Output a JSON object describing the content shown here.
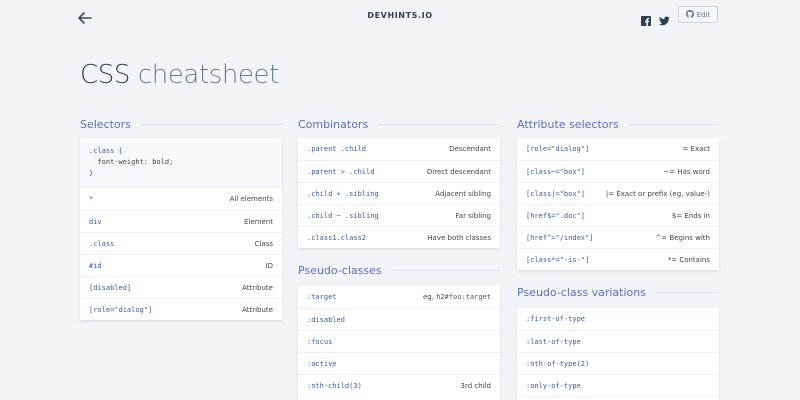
{
  "header": {
    "site_name": "DEVHINTS.IO",
    "edit_label": "Edit"
  },
  "title": {
    "main": "CSS",
    "light": "cheatsheet"
  },
  "selectors": {
    "title": "Selectors",
    "code_lines": [
      ".class {",
      "  font-weight: bold;",
      "}"
    ],
    "rows": [
      {
        "code": "*",
        "desc": "All elements"
      },
      {
        "code": "div",
        "desc": "Element"
      },
      {
        "code": ".class",
        "desc": "Class"
      },
      {
        "code": "#id",
        "desc": "ID"
      },
      {
        "code": "[disabled]",
        "desc": "Attribute"
      },
      {
        "code": "[role=\"dialog\"]",
        "desc": "Attribute"
      }
    ]
  },
  "combinators": {
    "title": "Combinators",
    "rows": [
      {
        "code": ".parent .child",
        "desc": "Descendant"
      },
      {
        "code": ".parent > .child",
        "desc": "Direct descendant"
      },
      {
        "code": ".child + .sibling",
        "desc": "Adjacent sibling"
      },
      {
        "code": ".child ~ .sibling",
        "desc": "Far sibling"
      },
      {
        "code": ".class1.class2",
        "desc": "Have both classes"
      }
    ]
  },
  "pseudo_classes": {
    "title": "Pseudo-classes",
    "rows": [
      {
        "code": ":target",
        "desc_prefix": "eg,",
        "desc_code": "h2#foo:target"
      },
      {
        "code": ":disabled",
        "desc": ""
      },
      {
        "code": ":focus",
        "desc": ""
      },
      {
        "code": ":active",
        "desc": ""
      },
      {
        "code": ":nth-child(3)",
        "desc": "3rd child"
      }
    ]
  },
  "attribute_selectors": {
    "title": "Attribute selectors",
    "rows": [
      {
        "code": "[role=\"dialog\"]",
        "desc": "= Exact"
      },
      {
        "code": "[class~=\"box\"]",
        "desc": "~= Has word"
      },
      {
        "code": "[class|=\"box\"]",
        "desc": "|= Exact or prefix (eg, value-)"
      },
      {
        "code": "[href$=\".doc\"]",
        "desc": "$= Ends in"
      },
      {
        "code": "[href^=\"/index\"]",
        "desc": "^= Begins with"
      },
      {
        "code": "[class*=\"-is-\"]",
        "desc": "*= Contains"
      }
    ]
  },
  "pseudo_class_variations": {
    "title": "Pseudo-class variations",
    "rows": [
      {
        "code": ":first-of-type"
      },
      {
        "code": ":last-of-type"
      },
      {
        "code": ":nth-of-type(2)"
      },
      {
        "code": ":only-of-type"
      },
      {
        "code": ""
      }
    ]
  }
}
